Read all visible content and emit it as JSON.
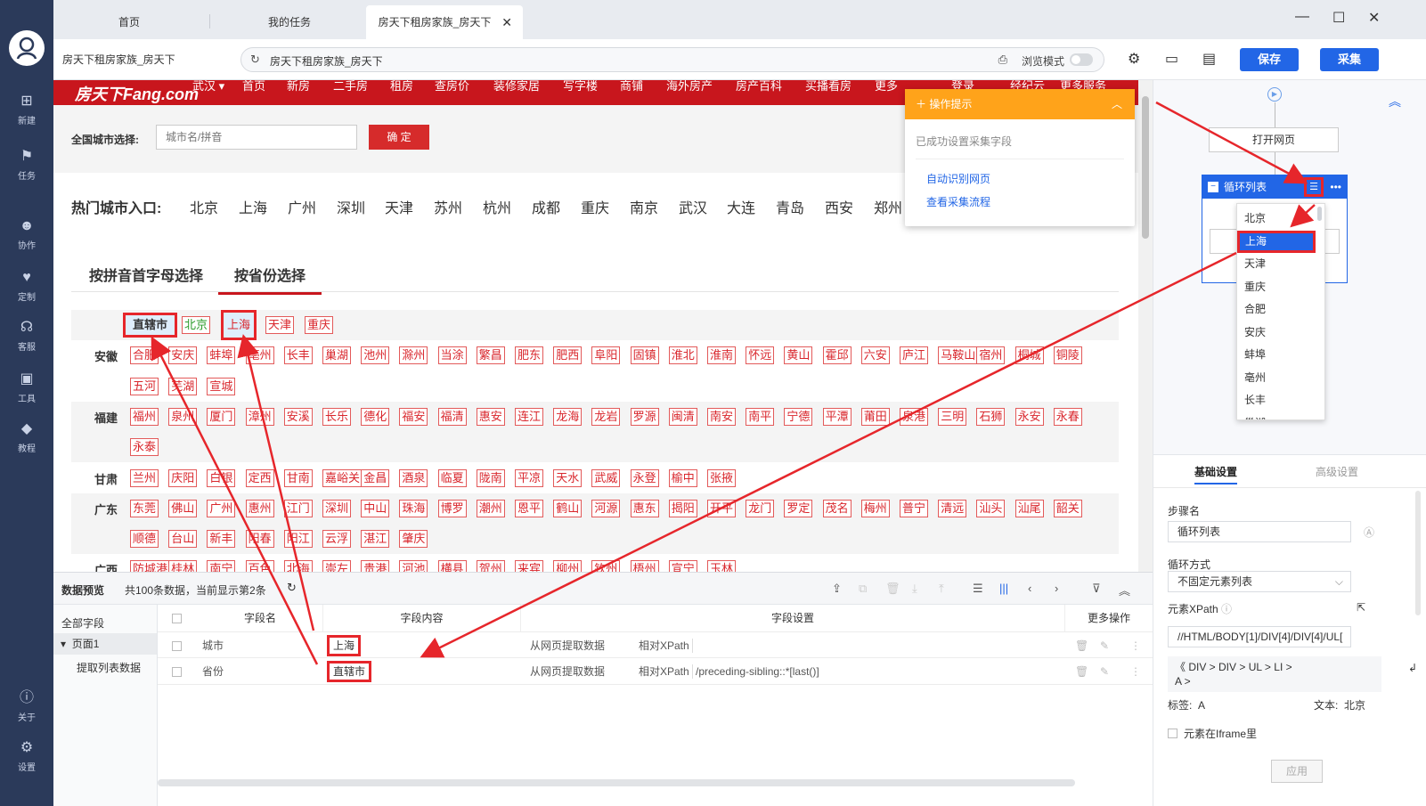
{
  "rail": {
    "items": [
      {
        "label": "新建",
        "icon": "new-icon"
      },
      {
        "label": "任务",
        "icon": "task-icon"
      },
      {
        "label": "协作",
        "icon": "collab-icon"
      },
      {
        "label": "定制",
        "icon": "custom-icon"
      },
      {
        "label": "客服",
        "icon": "support-icon"
      },
      {
        "label": "工具",
        "icon": "toolbox-icon"
      },
      {
        "label": "教程",
        "icon": "tutorial-icon"
      },
      {
        "label": "关于",
        "icon": "about-icon"
      },
      {
        "label": "设置",
        "icon": "settings-icon"
      }
    ]
  },
  "tabs": [
    {
      "label": "首页"
    },
    {
      "label": "我的任务"
    },
    {
      "label": "房天下租房家族_房天下",
      "active": true
    }
  ],
  "toolbar": {
    "page_name": "房天下租房家族_房天下",
    "address": "房天下租房家族_房天下",
    "browse_mode": "浏览模式",
    "save_label": "保存",
    "collect_label": "采集"
  },
  "site": {
    "brand": "房天下Fang.com",
    "city": "武汉",
    "nav": [
      "首页",
      "新房",
      "二手房",
      "租房",
      "查房价",
      "装修家居",
      "写字楼",
      "商铺",
      "海外房产",
      "房产百科",
      "买播看房",
      "更多",
      "登录",
      "经纪云",
      "更多服务"
    ],
    "city_select_label": "全国城市选择:",
    "city_input_placeholder": "城市名/拼音",
    "confirm_label": "确 定",
    "hot_label": "热门城市入口:",
    "hot_cities": [
      "北京",
      "上海",
      "广州",
      "深圳",
      "天津",
      "苏州",
      "杭州",
      "成都",
      "重庆",
      "南京",
      "武汉",
      "大连",
      "青岛",
      "西安",
      "郑州"
    ],
    "select_tabs": [
      "按拼音首字母选择",
      "按省份选择"
    ],
    "provinces": [
      {
        "name": "直辖市",
        "cities": [
          "北京",
          "上海",
          "天津",
          "重庆"
        ]
      },
      {
        "name": "安徽",
        "cities": [
          "合肥",
          "安庆",
          "蚌埠",
          "亳州",
          "长丰",
          "巢湖",
          "池州",
          "滁州",
          "当涂",
          "繁昌",
          "肥东",
          "肥西",
          "阜阳",
          "固镇",
          "淮北",
          "淮南",
          "怀远",
          "黄山",
          "霍邱",
          "六安",
          "庐江",
          "马鞍山",
          "宿州",
          "桐城",
          "铜陵",
          "五河",
          "芜湖",
          "宣城"
        ]
      },
      {
        "name": "福建",
        "cities": [
          "福州",
          "泉州",
          "厦门",
          "漳州",
          "安溪",
          "长乐",
          "德化",
          "福安",
          "福清",
          "惠安",
          "连江",
          "龙海",
          "龙岩",
          "罗源",
          "闽清",
          "南安",
          "南平",
          "宁德",
          "平潭",
          "莆田",
          "泉港",
          "三明",
          "石狮",
          "永安",
          "永春",
          "永泰"
        ]
      },
      {
        "name": "甘肃",
        "cities": [
          "兰州",
          "庆阳",
          "白银",
          "定西",
          "甘南",
          "嘉峪关",
          "金昌",
          "酒泉",
          "临夏",
          "陇南",
          "平凉",
          "天水",
          "武威",
          "永登",
          "榆中",
          "张掖"
        ]
      },
      {
        "name": "广东",
        "cities": [
          "东莞",
          "佛山",
          "广州",
          "惠州",
          "江门",
          "深圳",
          "中山",
          "珠海",
          "博罗",
          "潮州",
          "恩平",
          "鹤山",
          "河源",
          "惠东",
          "揭阳",
          "开平",
          "龙门",
          "罗定",
          "茂名",
          "梅州",
          "普宁",
          "清远",
          "汕头",
          "汕尾",
          "韶关",
          "顺德",
          "台山",
          "新丰",
          "阳春",
          "阳江",
          "云浮",
          "湛江",
          "肇庆"
        ]
      },
      {
        "name": "广西",
        "cities": [
          "防城港",
          "桂林",
          "南宁",
          "百色",
          "北海",
          "崇左",
          "贵港",
          "河池",
          "横县",
          "贺州",
          "来宾",
          "柳州",
          "钦州",
          "梧州",
          "宣宁",
          "玉林"
        ]
      }
    ]
  },
  "tip": {
    "title": "操作提示",
    "message": "已成功设置采集字段",
    "links": [
      "自动识别网页",
      "查看采集流程"
    ]
  },
  "flow": {
    "open_page": "打开网页",
    "loop_title": "循环列表",
    "dropdown": [
      "北京",
      "上海",
      "天津",
      "重庆",
      "合肥",
      "安庆",
      "蚌埠",
      "亳州",
      "长丰",
      "巢湖"
    ],
    "dropdown_selected": "上海"
  },
  "settings": {
    "tabs": [
      "基础设置",
      "高级设置"
    ],
    "step_name_label": "步骤名",
    "step_name": "循环列表",
    "loop_mode_label": "循环方式",
    "loop_mode": "不固定元素列表",
    "xpath_label": "元素XPath",
    "xpath": "//HTML/BODY[1]/DIV[4]/DIV[4]/UL[",
    "breadcrumb_line1": "《  DIV  >  DIV  >  UL  >  LI  >",
    "breadcrumb_line2": "A  >",
    "tag_label": "标签:",
    "tag_value": "A",
    "text_label": "文本:",
    "text_value": "北京",
    "iframe_label": "元素在Iframe里",
    "apply": "应用"
  },
  "preview": {
    "title": "数据预览",
    "count": "共100条数据，当前显示第2条",
    "tree": {
      "all_fields": "全部字段",
      "page": "页面1",
      "extract": "提取列表数据"
    },
    "columns": [
      "字段名",
      "字段内容",
      "字段设置",
      "更多操作"
    ],
    "rows": [
      {
        "field": "城市",
        "value": "上海",
        "source": "从网页提取数据",
        "locator": "相对XPath",
        "xpath": ""
      },
      {
        "field": "省份",
        "value": "直辖市",
        "source": "从网页提取数据",
        "locator": "相对XPath",
        "xpath": "/preceding-sibling::*[last()]"
      }
    ]
  },
  "colors": {
    "accent": "#2266e6",
    "site_red": "#c8161d",
    "tip_orange": "#ffa31a",
    "highlight_red": "#e6262b"
  }
}
